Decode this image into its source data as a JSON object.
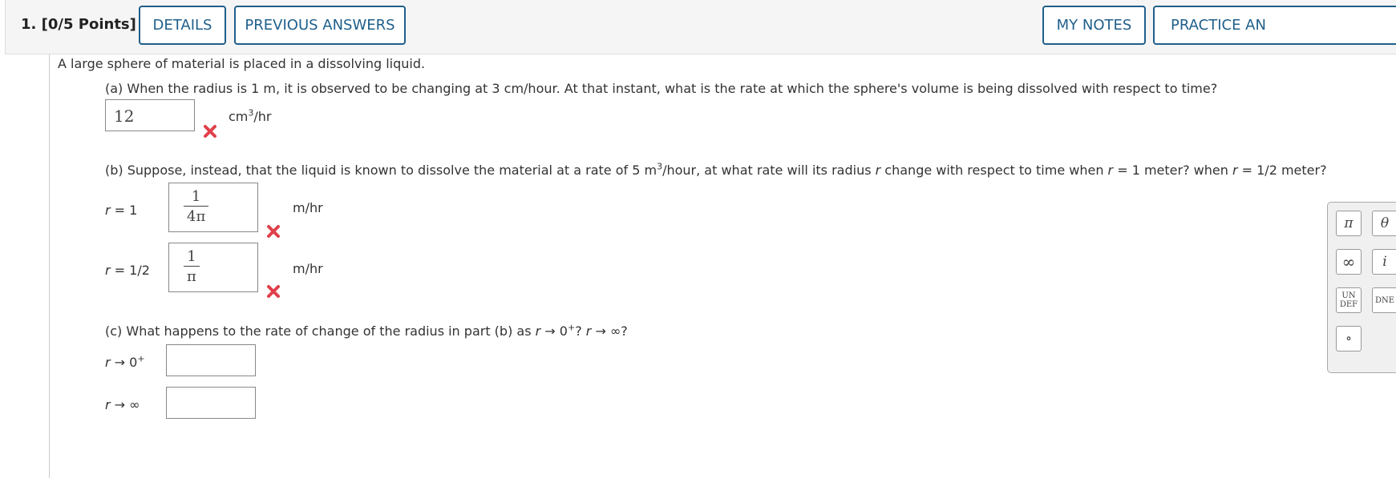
{
  "header": {
    "question_number": "1.",
    "points": "[0/5 Points]",
    "buttons": {
      "details": "DETAILS",
      "previous_answers": "PREVIOUS ANSWERS",
      "my_notes": "MY NOTES",
      "practice": "PRACTICE AN"
    }
  },
  "problem": {
    "intro": "A large sphere of material is placed in a dissolving liquid.",
    "part_a": {
      "text": "(a) When the radius is 1 m, it is observed to be changing at 3 cm/hour. At that instant, what is the rate at which the sphere's volume is being dissolved with respect to time?",
      "answer": "12",
      "unit_base": "cm",
      "unit_exp": "3",
      "unit_tail": "/hr",
      "status": "incorrect"
    },
    "part_b": {
      "text_1": "(b) Suppose, instead, that the liquid is known to dissolve the material at a rate of 5 m",
      "text_exp": "3",
      "text_2": "/hour, at what rate will its radius ",
      "text_var1": "r",
      "text_3": " change with respect to time when ",
      "text_var2": "r",
      "text_4": " = 1 meter? when ",
      "text_var3": "r",
      "text_5": " = 1/2 meter?",
      "rows": [
        {
          "var": "r",
          "eq": " = 1",
          "num": "1",
          "den": "4π",
          "unit": "m/hr",
          "status": "incorrect"
        },
        {
          "var": "r",
          "eq": " = 1/2",
          "num": "1",
          "den": "π",
          "unit": "m/hr",
          "status": "incorrect"
        }
      ]
    },
    "part_c": {
      "text_1": "(c) What happens to the rate of change of the radius in part (b) as ",
      "text_var1": "r",
      "text_2": " → 0",
      "text_sup": "+",
      "text_3": "? ",
      "text_var2": "r",
      "text_4": " → ∞?",
      "rows": [
        {
          "var": "r",
          "arrow": " → 0",
          "sup": "+",
          "answer": ""
        },
        {
          "var": "r",
          "arrow": " → ∞",
          "sup": "",
          "answer": ""
        }
      ]
    }
  },
  "palette": {
    "keys": [
      "π",
      "θ",
      "∞",
      "i",
      "UN DEF",
      "DNE",
      "∘"
    ]
  },
  "colors": {
    "accent": "#1f5f8b",
    "error": "#e0404a"
  }
}
